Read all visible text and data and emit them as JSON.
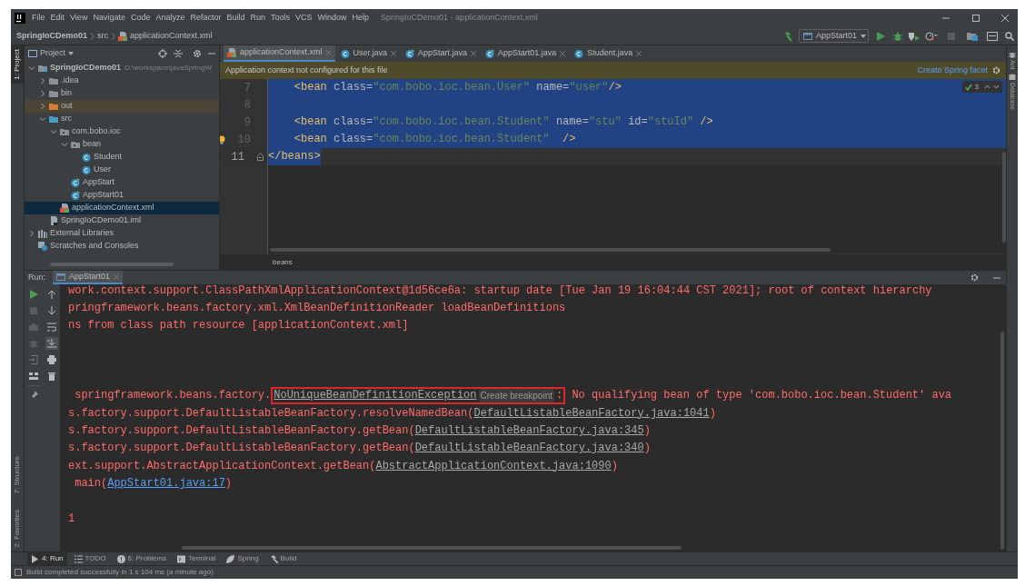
{
  "window": {
    "title": "SpringIoCDemo01 - applicationContext.xml"
  },
  "menu": [
    "File",
    "Edit",
    "View",
    "Navigate",
    "Code",
    "Analyze",
    "Refactor",
    "Build",
    "Run",
    "Tools",
    "VCS",
    "Window",
    "Help"
  ],
  "breadcrumbs": [
    "SpringIoCDemo01",
    "src",
    "applicationContext.xml"
  ],
  "run_config": "AppStart01",
  "left_stripe": [
    {
      "label": "1: Project",
      "selected": true
    },
    {
      "label": "7: Structure",
      "selected": false
    },
    {
      "label": "2: Favorites",
      "selected": false
    }
  ],
  "right_stripe": [
    {
      "label": "Ant"
    },
    {
      "label": "Database"
    }
  ],
  "project_panel": {
    "title": "Project",
    "tree": [
      {
        "label": "SpringIoCDemo01",
        "note": "D:\\workspace\\javaSpringW",
        "kind": "module",
        "expanded": true,
        "selected": false,
        "children": [
          {
            "label": ".idea",
            "kind": "folder",
            "expanded": false,
            "selected": false
          },
          {
            "label": "bin",
            "kind": "folder",
            "expanded": false,
            "selected": false
          },
          {
            "label": "out",
            "kind": "excluded-folder",
            "expanded": false,
            "selected": false
          },
          {
            "label": "src",
            "kind": "source-folder",
            "expanded": true,
            "selected": false,
            "children": [
              {
                "label": "com.bobo.ioc",
                "kind": "package",
                "expanded": true,
                "selected": false,
                "children": [
                  {
                    "label": "bean",
                    "kind": "package",
                    "expanded": true,
                    "selected": false,
                    "children": [
                      {
                        "label": "Student",
                        "kind": "class",
                        "selected": false
                      },
                      {
                        "label": "User",
                        "kind": "class",
                        "selected": false
                      }
                    ]
                  },
                  {
                    "label": "AppStart",
                    "kind": "main-class",
                    "selected": false
                  },
                  {
                    "label": "AppStart01",
                    "kind": "main-class",
                    "selected": false
                  }
                ]
              },
              {
                "label": "applicationContext.xml",
                "kind": "xml",
                "selected": true
              }
            ]
          },
          {
            "label": "SpringIoCDemo01.iml",
            "kind": "iml",
            "selected": false
          }
        ]
      },
      {
        "label": "External Libraries",
        "kind": "libraries",
        "expanded": false,
        "selected": false
      },
      {
        "label": "Scratches and Consoles",
        "kind": "scratches",
        "selected": false
      }
    ]
  },
  "editor": {
    "tabs": [
      {
        "label": "applicationContext.xml",
        "kind": "xml",
        "selected": true
      },
      {
        "label": "User.java",
        "kind": "class",
        "selected": false
      },
      {
        "label": "AppStart.java",
        "kind": "main-class",
        "selected": false
      },
      {
        "label": "AppStart01.java",
        "kind": "main-class",
        "selected": false
      },
      {
        "label": "Student.java",
        "kind": "class",
        "selected": false
      }
    ],
    "notice": {
      "text": "Application context not configured for this file",
      "action": "Create Spring facet"
    },
    "inspections": "3",
    "lines": [
      {
        "number": "7",
        "code": "    <bean class=\"com.bobo.ioc.bean.User\" name=\"user\"/>",
        "selected": true,
        "current": false,
        "intention": false
      },
      {
        "number": "8",
        "selected": true,
        "current": false,
        "intention": false
      },
      {
        "number": "9",
        "code": "    <bean class=\"com.bobo.ioc.bean.Student\" name=\"stu\" id=\"stuId\" />",
        "selected": true,
        "current": false,
        "intention": false
      },
      {
        "number": "10",
        "code": "    <bean class=\"com.bobo.ioc.bean.Student\"  />",
        "selected": true,
        "current": false,
        "intention": true
      },
      {
        "number": "11",
        "code": "</beans>",
        "selected": true,
        "current": true,
        "intention": false
      }
    ],
    "breadcrumb": "beans"
  },
  "run_panel": {
    "label": "Run:",
    "tab": "AppStart01",
    "console": [
      {
        "kind": "text",
        "segments": [
          {
            "kind": "error",
            "text": "work.context.support.ClassPathXmlApplicationContext@1d56ce6a: startup date [Tue Jan 19 16:04:44 CST 2021]; root of context hierarchy"
          }
        ]
      },
      {
        "kind": "text",
        "segments": [
          {
            "kind": "error",
            "text": "pringframework.beans.factory.xml.XmlBeanDefinitionReader loadBeanDefinitions"
          }
        ]
      },
      {
        "kind": "text",
        "segments": [
          {
            "kind": "error",
            "text": "ns from class path resource [applicationContext.xml]"
          }
        ]
      },
      {
        "kind": "blank"
      },
      {
        "kind": "blank"
      },
      {
        "kind": "blank"
      },
      {
        "kind": "text",
        "segments": [
          {
            "kind": "error",
            "text": " springframework.beans.factory."
          },
          {
            "kind": "file-link",
            "text": "NoUniqueBeanDefinitionException",
            "boxed": true
          },
          {
            "kind": "inlay",
            "text": "Create breakpoint",
            "boxed": true
          },
          {
            "kind": "error",
            "text": ":",
            "boxed": true
          },
          {
            "kind": "error",
            "text": " No qualifying bean of type 'com.bobo.ioc.bean.Student' ava"
          }
        ]
      },
      {
        "kind": "text",
        "segments": [
          {
            "kind": "error",
            "text": "s.factory.support.DefaultListableBeanFactory.resolveNamedBean("
          },
          {
            "kind": "file-link",
            "text": "DefaultListableBeanFactory.java:1041"
          },
          {
            "kind": "error",
            "text": ")"
          }
        ]
      },
      {
        "kind": "text",
        "segments": [
          {
            "kind": "error",
            "text": "s.factory.support.DefaultListableBeanFactory.getBean("
          },
          {
            "kind": "file-link",
            "text": "DefaultListableBeanFactory.java:345"
          },
          {
            "kind": "error",
            "text": ")"
          }
        ]
      },
      {
        "kind": "text",
        "segments": [
          {
            "kind": "error",
            "text": "s.factory.support.DefaultListableBeanFactory.getBean("
          },
          {
            "kind": "file-link",
            "text": "DefaultListableBeanFactory.java:340"
          },
          {
            "kind": "error",
            "text": ")"
          }
        ]
      },
      {
        "kind": "text",
        "segments": [
          {
            "kind": "error",
            "text": "ext.support.AbstractApplicationContext.getBean("
          },
          {
            "kind": "file-link",
            "text": "AbstractApplicationContext.java:1090"
          },
          {
            "kind": "error",
            "text": ")"
          }
        ]
      },
      {
        "kind": "text",
        "segments": [
          {
            "kind": "error",
            "text": " main("
          },
          {
            "kind": "link",
            "text": "AppStart01.java:17"
          },
          {
            "kind": "error",
            "text": ")"
          }
        ]
      },
      {
        "kind": "blank"
      },
      {
        "kind": "text",
        "segments": [
          {
            "kind": "error",
            "text": "1"
          }
        ]
      }
    ]
  },
  "tool_windows": [
    {
      "label": "4: Run",
      "kind": "run",
      "selected": true
    },
    {
      "label": "TODO",
      "kind": "todo",
      "selected": false
    },
    {
      "label": "6: Problems",
      "kind": "problems",
      "selected": false
    },
    {
      "label": "Terminal",
      "kind": "terminal",
      "selected": false
    },
    {
      "label": "Spring",
      "kind": "spring",
      "selected": false
    },
    {
      "label": "Build",
      "kind": "build",
      "selected": false
    }
  ],
  "status_bar": "Build completed successfully in 1 s 104 ms (a minute ago)"
}
